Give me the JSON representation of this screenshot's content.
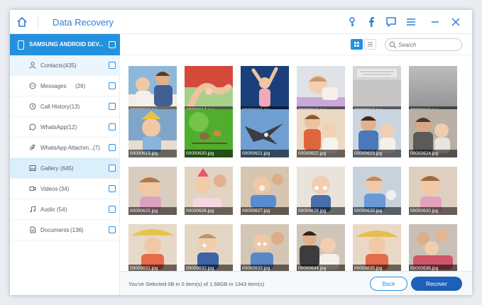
{
  "app": {
    "title": "Data Recovery"
  },
  "sidebar": {
    "device": "SAMSUNG ANDROID DEV...",
    "items": [
      {
        "label": "Contacts",
        "count": "(435)",
        "icon": "person-icon"
      },
      {
        "label": "Messages",
        "count": "(26)",
        "icon": "message-icon"
      },
      {
        "label": "Call History",
        "count": "(13)",
        "icon": "clock-icon"
      },
      {
        "label": "WhatsApp",
        "count": "(12)",
        "icon": "whatsapp-icon"
      },
      {
        "label": "WhatsApp Attachm...",
        "count": "(7)",
        "icon": "paperclip-icon"
      },
      {
        "label": "Gallery",
        "count": "(645)",
        "icon": "image-icon"
      },
      {
        "label": "Videos",
        "count": "(34)",
        "icon": "video-icon"
      },
      {
        "label": "Audio",
        "count": "(54)",
        "icon": "music-icon"
      },
      {
        "label": "Documents",
        "count": "(136)",
        "icon": "document-icon"
      }
    ]
  },
  "search": {
    "placeholder": "Search"
  },
  "gallery": {
    "files": [
      "00000613.jpg",
      "00000614.jpg",
      "00000615.jpg",
      "00000616.jpg",
      "00000617.jpg",
      "00000618.jpg",
      "00000619.jpg",
      "00000620.jpg",
      "00000621.jpg",
      "00000622.jpg",
      "00000623.jpg",
      "00000624.jpg",
      "00000625.jpg",
      "00000626.jpg",
      "00000627.jpg",
      "00000628.jpg",
      "00000629.jpg",
      "00000630.jpg",
      "00000631.jpg",
      "00000632.jpg",
      "00000633.jpg",
      "00000634.jpg",
      "00000635.jpg",
      "00000636.jpg"
    ]
  },
  "footer": {
    "status": "You've Selected 0B in 0 item(s) of 1.58GB in 1343 item(s)",
    "back_label": "Back",
    "recover_label": "Recover"
  },
  "colors": {
    "accent": "#2491de",
    "recover": "#1e5fb8"
  }
}
